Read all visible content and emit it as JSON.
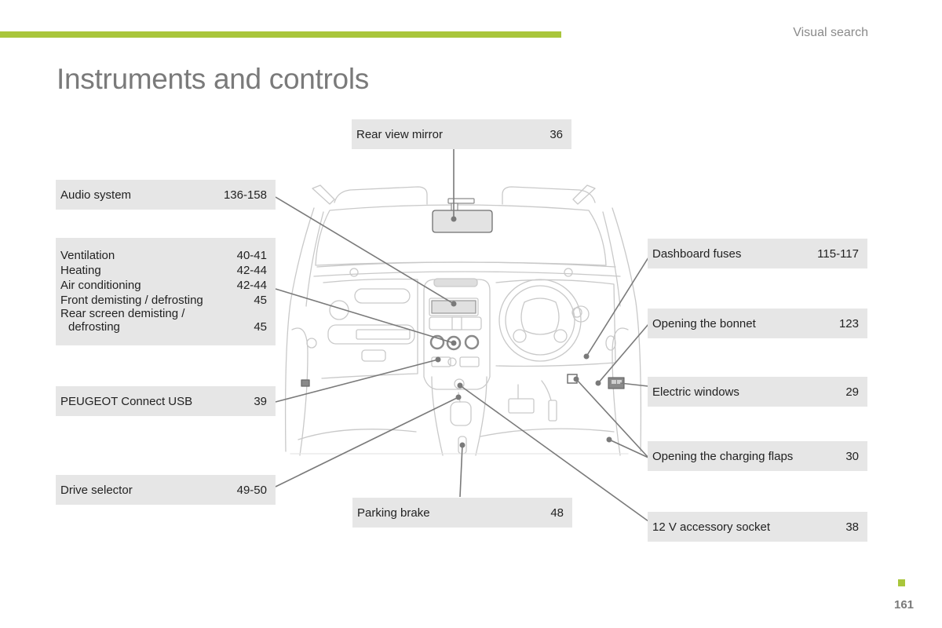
{
  "header": {
    "section": "Visual search",
    "title": "Instruments and controls",
    "accent_color": "#a9c63b"
  },
  "callouts": {
    "rear_view_mirror": {
      "label": "Rear view mirror",
      "page": "36"
    },
    "audio_system": {
      "label": "Audio system",
      "page": "136-158"
    },
    "climate": {
      "rows": [
        {
          "label": "Ventilation",
          "page": "40-41"
        },
        {
          "label": "Heating",
          "page": "42-44"
        },
        {
          "label": "Air conditioning",
          "page": "42-44"
        },
        {
          "label": "Front demisting / defrosting",
          "page": "45"
        },
        {
          "label": "Rear screen demisting /",
          "page": ""
        },
        {
          "label": "defrosting",
          "page": "45"
        }
      ]
    },
    "usb": {
      "label": "PEUGEOT Connect USB",
      "page": "39"
    },
    "drive_selector": {
      "label": "Drive selector",
      "page": "49-50"
    },
    "parking_brake": {
      "label": "Parking brake",
      "page": "48"
    },
    "dashboard_fuses": {
      "label": "Dashboard fuses",
      "page": "115-117"
    },
    "bonnet": {
      "label": "Opening the bonnet",
      "page": "123"
    },
    "electric_windows": {
      "label": "Electric windows",
      "page": "29"
    },
    "charging_flaps": {
      "label": "Opening the charging flaps",
      "page": "30"
    },
    "accessory_socket": {
      "label": "12 V accessory socket",
      "page": "38"
    }
  },
  "footer": {
    "page_number": "161"
  }
}
